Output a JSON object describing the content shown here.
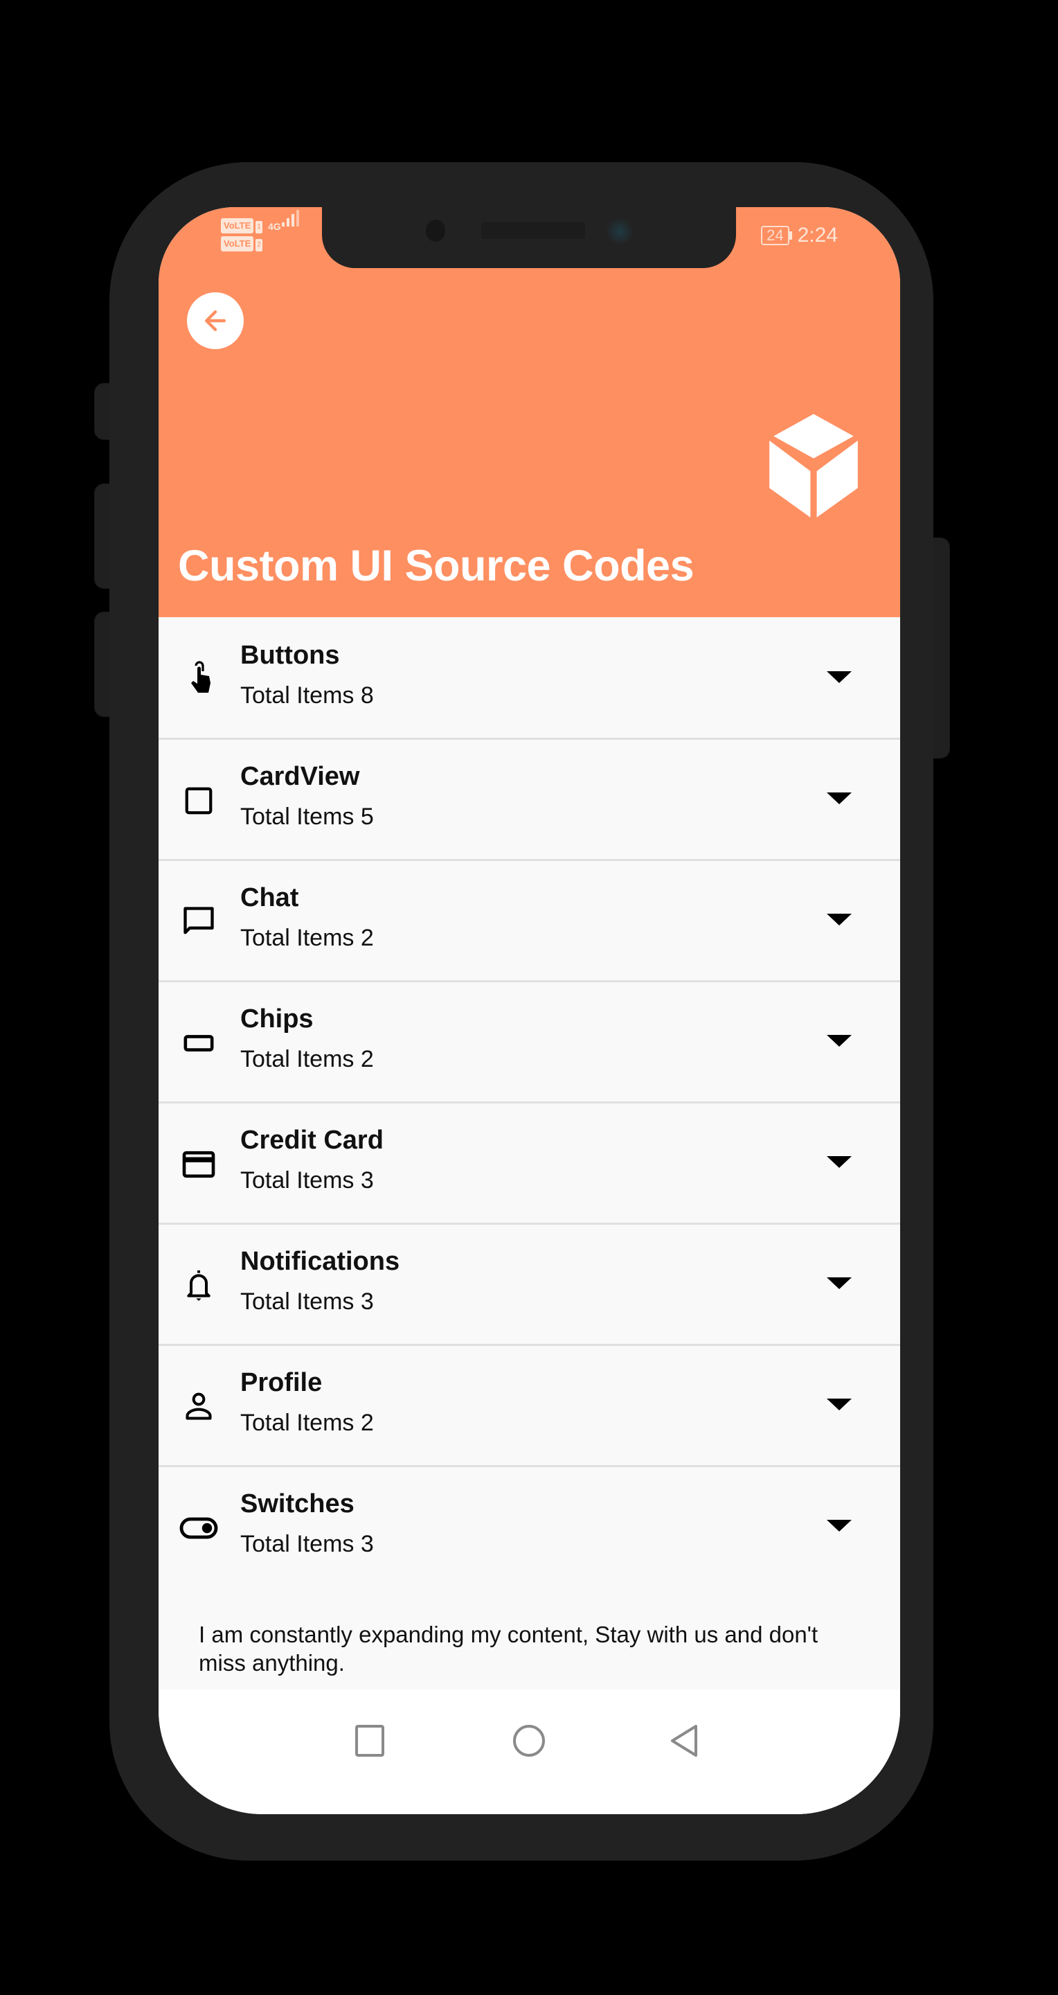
{
  "status_bar": {
    "sim1_label": "VoLTE",
    "sim1_num": "1",
    "sim2_label": "VoLTE",
    "sim2_num": "2",
    "network": "4G",
    "battery_level": "24",
    "time": "2:24"
  },
  "header": {
    "title": "Custom UI Source Codes",
    "back_icon": "arrow-left-icon",
    "hero_icon": "cube-icon",
    "accent_color": "#fe8f61"
  },
  "categories": [
    {
      "title": "Buttons",
      "subtitle": "Total Items 8",
      "icon": "touch-icon"
    },
    {
      "title": "CardView",
      "subtitle": "Total Items 5",
      "icon": "crop-square-icon"
    },
    {
      "title": "Chat",
      "subtitle": "Total Items 2",
      "icon": "chat-bubble-icon"
    },
    {
      "title": "Chips",
      "subtitle": "Total Items 2",
      "icon": "chip-icon"
    },
    {
      "title": "Credit Card",
      "subtitle": "Total Items 3",
      "icon": "credit-card-icon"
    },
    {
      "title": "Notifications",
      "subtitle": "Total Items 3",
      "icon": "bell-icon"
    },
    {
      "title": "Profile",
      "subtitle": "Total Items 2",
      "icon": "person-icon"
    },
    {
      "title": "Switches",
      "subtitle": "Total Items 3",
      "icon": "toggle-icon"
    }
  ],
  "footer_note": "I am constantly expanding my content, Stay with us and don't miss anything.",
  "navbar": {
    "recents_icon": "square-icon",
    "home_icon": "circle-icon",
    "back_icon": "triangle-back-icon"
  }
}
